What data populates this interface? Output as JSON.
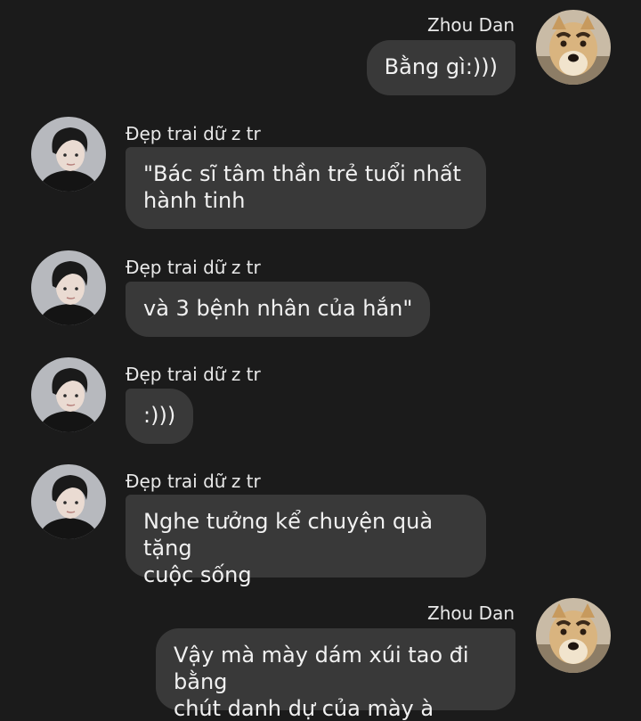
{
  "messages": [
    {
      "sender": "Zhou Dan",
      "text": "Bằng gì:)))"
    },
    {
      "sender": "Đẹp trai dữ z tr",
      "text_lines": [
        "\"Bác sĩ tâm thần trẻ tuổi nhất",
        "hành tinh"
      ]
    },
    {
      "sender": "Đẹp trai dữ z tr",
      "text": "và 3 bệnh nhân của hắn\""
    },
    {
      "sender": "Đẹp trai dữ z tr",
      "text": ":)))"
    },
    {
      "sender": "Đẹp trai dữ z tr",
      "text_lines": [
        "Nghe tưởng kể chuyện quà tặng",
        "cuộc sống"
      ]
    },
    {
      "sender": "Zhou Dan",
      "text_lines": [
        "Vậy mà mày dám xúi tao đi bằng",
        "chút danh dự của mày à"
      ]
    }
  ],
  "avatars": {
    "zhou_dan": "dog-avatar",
    "dep_trai": "person-avatar"
  },
  "colors": {
    "background": "#1b1b1b",
    "bubble": "#393939",
    "text": "#f1f1f1"
  }
}
